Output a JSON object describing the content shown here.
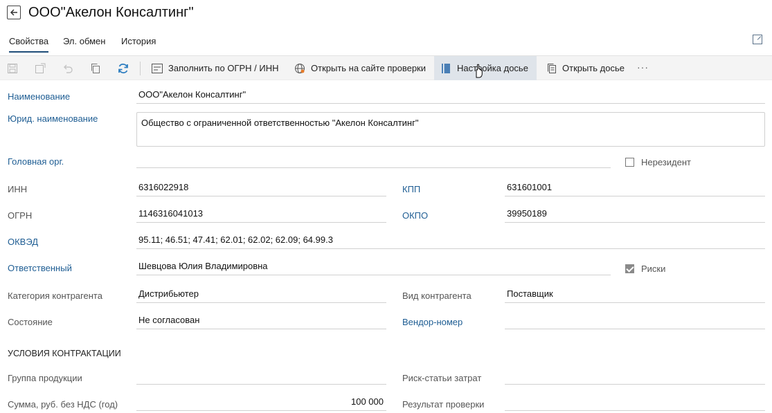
{
  "header": {
    "title": "ООО\"Акелон Консалтинг\""
  },
  "tabs": [
    {
      "label": "Свойства"
    },
    {
      "label": "Эл. обмен"
    },
    {
      "label": "История"
    }
  ],
  "toolbar": {
    "fill_label": "Заполнить по ОГРН / ИНН",
    "open_check_label": "Открыть на сайте проверки",
    "dossier_settings_label": "Настройка досье",
    "open_dossier_label": "Открыть досье",
    "more_label": "···"
  },
  "form": {
    "name_label": "Наименование",
    "name_value": "ООО\"Акелон Консалтинг\"",
    "legal_name_label": "Юрид. наименование",
    "legal_name_value": "Общество с ограниченной ответственностью \"Акелон Консалтинг\"",
    "head_org_label": "Головная орг.",
    "head_org_value": "",
    "nonresident_label": "Нерезидент",
    "inn_label": "ИНН",
    "inn_value": "6316022918",
    "kpp_label": "КПП",
    "kpp_value": "631601001",
    "ogrn_label": "ОГРН",
    "ogrn_value": "1146316041013",
    "okpo_label": "ОКПО",
    "okpo_value": "39950189",
    "okved_label": "ОКВЭД",
    "okved_value": "95.11; 46.51; 47.41; 62.01; 62.02; 62.09; 64.99.3",
    "responsible_label": "Ответственный",
    "responsible_value": "Шевцова Юлия Владимировна",
    "risks_label": "Риски",
    "category_label": "Категория контрагента",
    "category_value": "Дистрибьютер",
    "kind_label": "Вид контрагента",
    "kind_value": "Поставщик",
    "state_label": "Состояние",
    "state_value": "Не согласован",
    "vendor_label": "Вендор-номер",
    "vendor_value": "",
    "section_title": "УСЛОВИЯ КОНТРАКТАЦИИ",
    "product_group_label": "Группа продукции",
    "product_group_value": "",
    "cost_risk_label": "Риск-статьи затрат",
    "cost_risk_value": "",
    "sum_label": "Сумма, руб. без НДС (год)",
    "sum_value": "100 000",
    "check_result_label": "Результат проверки",
    "check_result_value": ""
  },
  "state": {
    "nonresident_checked": false,
    "risks_checked": true
  },
  "colors": {
    "accent": "#1e4d78",
    "link": "#1e5d93",
    "refresh": "#2f7fc1"
  }
}
